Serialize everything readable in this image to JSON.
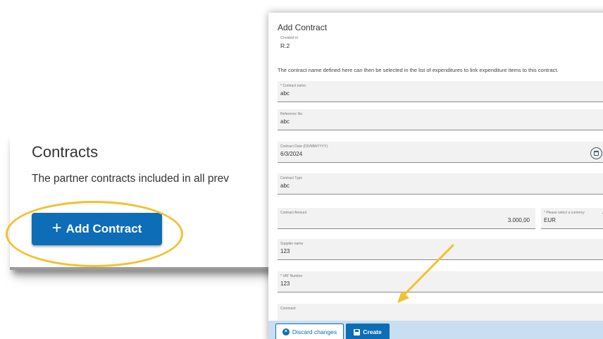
{
  "contracts": {
    "title": "Contracts",
    "description": "The partner contracts included in all prev",
    "add_button_label": "Add Contract"
  },
  "dialog": {
    "title": "Add Contract",
    "created_in_label": "Created in",
    "created_in_value": "R.2",
    "info_text": "The contract name defined here can then be selected in the list of expenditures to link expenditure items to this contract.",
    "fields": {
      "contract_name": {
        "label": "* Contract name",
        "value": "abc"
      },
      "reference_no": {
        "label": "Reference No.",
        "value": "abc"
      },
      "contract_date": {
        "label": "Contract Date (DD/MM/YYYY)",
        "value": "6/3/2024"
      },
      "contract_type": {
        "label": "Contract Type",
        "value": "abc"
      },
      "contract_amount": {
        "label": "Contract Amount",
        "value": "3.000,00"
      },
      "currency": {
        "label": "* Please select a currency",
        "value": "EUR"
      },
      "supplier_name": {
        "label": "Supplier name",
        "value": "123"
      },
      "vat_number": {
        "label": "* VAT Number",
        "value": "123"
      },
      "comment": {
        "label": "Comment",
        "value": ""
      }
    },
    "buttons": {
      "discard_label": "Discard changes",
      "create_label": "Create"
    }
  },
  "colors": {
    "primary": "#0d6db7",
    "highlight": "#f2c12e",
    "footer_bg": "#c9def1",
    "field_bg": "#f2f2f2"
  },
  "icons": {
    "plus": "plus-icon",
    "calendar": "calendar-icon",
    "discard": "x-circle-icon",
    "create": "save-icon"
  }
}
